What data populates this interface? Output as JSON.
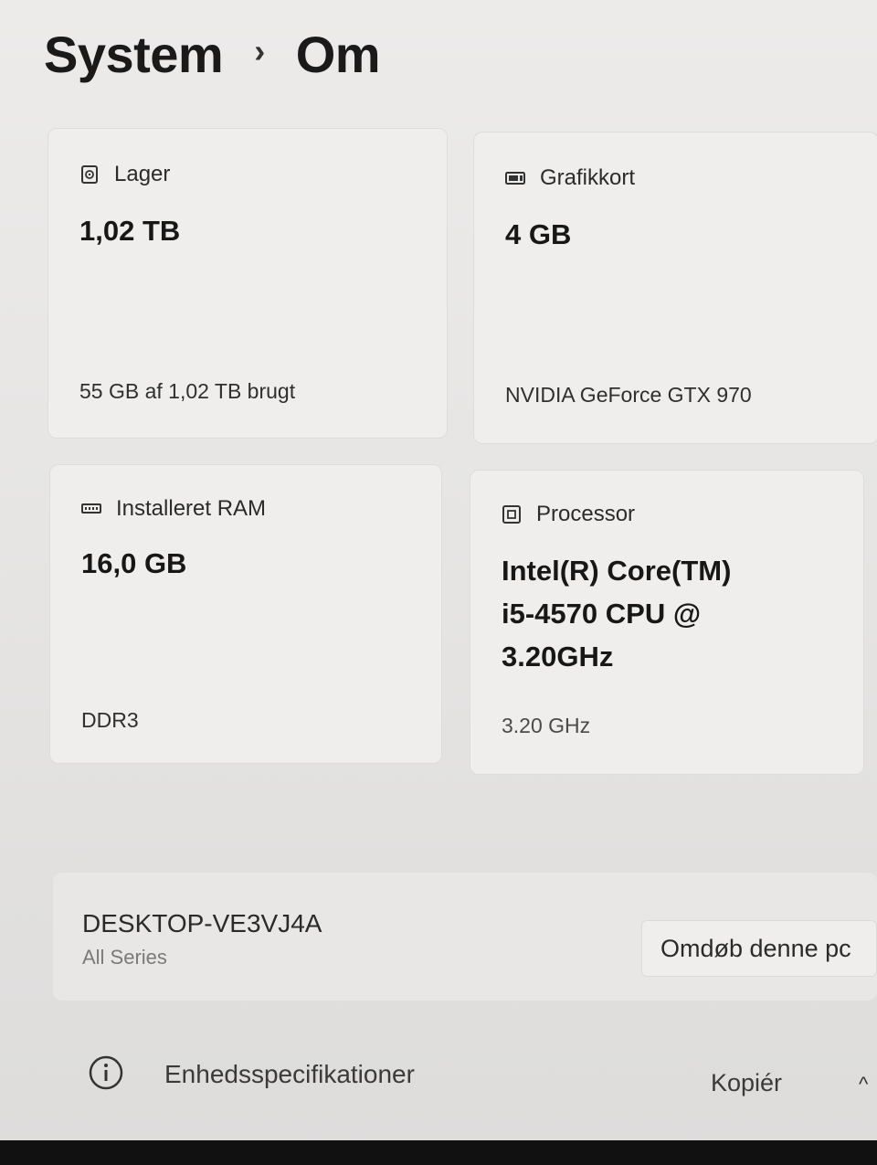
{
  "breadcrumb": {
    "parent": "System",
    "separator": "›",
    "current": "Om"
  },
  "cards": {
    "storage": {
      "icon": "storage-drive-icon",
      "label": "Lager",
      "value": "1,02 TB",
      "detail": "55 GB af 1,02 TB brugt"
    },
    "graphics": {
      "icon": "graphics-card-icon",
      "label": "Grafikkort",
      "value": "4 GB",
      "detail": "NVIDIA GeForce GTX 970"
    },
    "ram": {
      "icon": "ram-icon",
      "label": "Installeret RAM",
      "value": "16,0 GB",
      "detail": "DDR3"
    },
    "processor": {
      "icon": "processor-icon",
      "label": "Processor",
      "value_lines": [
        "Intel(R) Core(TM)",
        "i5-4570 CPU @",
        "3.20GHz"
      ],
      "detail": "3.20 GHz"
    }
  },
  "device": {
    "name": "DESKTOP-VE3VJ4A",
    "model": "All Series",
    "rename_label": "Omdøb denne pc"
  },
  "specs": {
    "icon": "info-icon",
    "title": "Enhedsspecifikationer",
    "copy_label": "Kopiér",
    "expand_icon": "chevron-up-icon",
    "expand_glyph": "^"
  }
}
